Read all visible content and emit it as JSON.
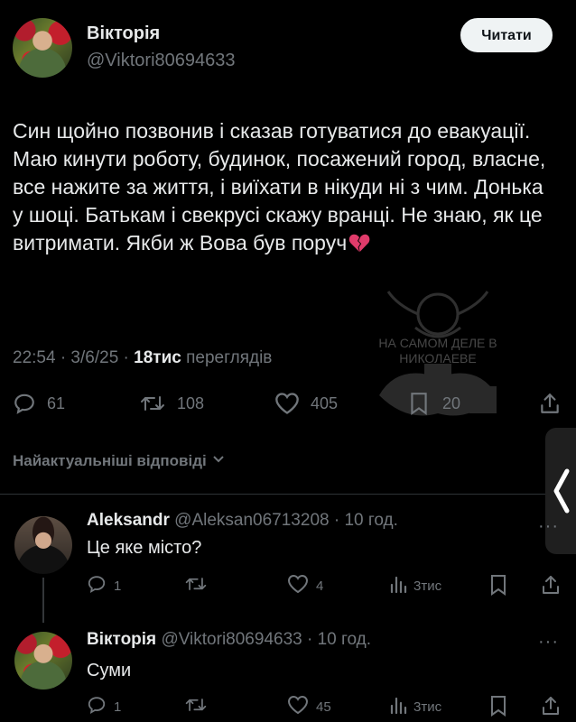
{
  "tweet": {
    "author_name": "Вікторія",
    "handle": "@Viktori80694633",
    "follow_label": "Читати",
    "text": "Син щойно позвонив і сказав готуватися до евакуації. Маю кинути роботу, будинок, посажений город, власне, все нажите за життя, і виїхати в нікуди ні з чим. Донька у шоці. Батькам і свекрусі скажу вранці. Не знаю, як це витримати. Якби ж Вова був поруч",
    "emoji_icon": "broken-heart-icon",
    "time_date": "22:54 · 3/6/25 · ",
    "views_count": "18тис",
    "views_label": " переглядів",
    "stats": {
      "replies": "61",
      "reposts": "108",
      "likes": "405",
      "bookmarks": "20"
    }
  },
  "watermark": {
    "line1": "НА САМОМ ДЕЛЕ В",
    "line2": "НИКОЛАЕВЕ"
  },
  "replies_header": "Найактуальніші відповіді",
  "replies": [
    {
      "author_name": "Aleksandr",
      "handle": "@Aleksan06713208",
      "time": " · 10 год.",
      "text": "Це яке місто?",
      "stats": {
        "replies": "1",
        "reposts": "",
        "likes": "4",
        "views": "3тис"
      }
    },
    {
      "author_name": "Вікторія",
      "handle": "@Viktori80694633",
      "time": " · 10 год.",
      "text": "Суми",
      "stats": {
        "replies": "1",
        "reposts": "",
        "likes": "45",
        "views": "3тис"
      }
    }
  ],
  "colors": {
    "background": "#000000",
    "text": "#e7e9ea",
    "muted": "#71767b",
    "follow_bg": "#eff3f4"
  }
}
